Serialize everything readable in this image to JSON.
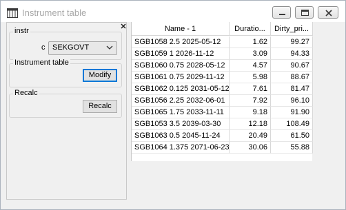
{
  "window": {
    "title": "Instrument table"
  },
  "left_panel": {
    "instr_group": {
      "legend": "instr",
      "combo_label": "c",
      "combo_value": "SEKGOVT"
    },
    "instrument_table_group": {
      "legend": "Instrument table",
      "button_label": "Modify"
    },
    "recalc_group": {
      "legend": "Recalc",
      "button_label": "Recalc"
    }
  },
  "table": {
    "columns": [
      "Name - 1",
      "Duratio...",
      "Dirty_pri..."
    ],
    "rows": [
      [
        "SGB1058 2.5 2025-05-12",
        "1.62",
        "99.27"
      ],
      [
        "SGB1059 1 2026-11-12",
        "3.09",
        "94.33"
      ],
      [
        "SGB1060 0.75 2028-05-12",
        "4.57",
        "90.67"
      ],
      [
        "SGB1061 0.75 2029-11-12",
        "5.98",
        "88.67"
      ],
      [
        "SGB1062 0.125 2031-05-12",
        "7.61",
        "81.47"
      ],
      [
        "SGB1056 2.25 2032-06-01",
        "7.92",
        "96.10"
      ],
      [
        "SGB1065 1.75 2033-11-11",
        "9.18",
        "91.90"
      ],
      [
        "SGB1053 3.5 2039-03-30",
        "12.18",
        "108.49"
      ],
      [
        "SGB1063 0.5 2045-11-24",
        "20.49",
        "61.50"
      ],
      [
        "SGB1064 1.375 2071-06-23",
        "30.06",
        "55.88"
      ]
    ]
  },
  "icons": {
    "app": "table-icon",
    "minimize": "minimize-icon",
    "maximize": "maximize-icon",
    "close": "close-icon",
    "panel_close": "close-icon",
    "dropdown": "chevron-down-icon"
  }
}
